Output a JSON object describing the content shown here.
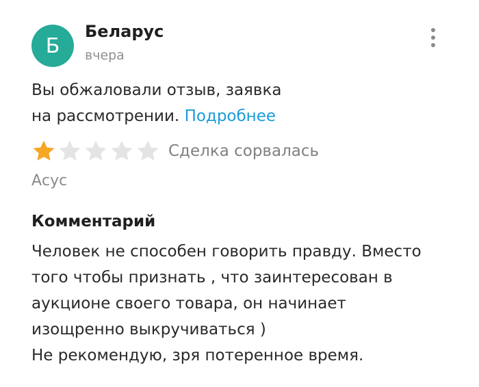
{
  "review": {
    "author": {
      "initial": "Б",
      "name": "Беларус",
      "avatar_color": "#26ab98"
    },
    "date": "вчера",
    "menu_icon": "more-vertical-icon",
    "appeal": {
      "line1": "Вы обжаловали отзыв, заявка",
      "line2": "на рассмотрении.",
      "link": "Подробнее",
      "link_color": "#1a9bd8"
    },
    "rating": {
      "value": 1,
      "max": 5,
      "filled_color": "#f5a623",
      "empty_color": "#e4e4e4"
    },
    "deal_status": "Сделка сорвалась",
    "product": "Асус",
    "comment": {
      "heading": "Комментарий",
      "lines": [
        "Человек не способен говорить правду. Вместо",
        "того чтобы признать , что заинтересован в",
        "аукционе своего товара, он начинает",
        "изощренно выкручиваться )",
        "Не рекомендую, зря потеренное время."
      ]
    }
  }
}
